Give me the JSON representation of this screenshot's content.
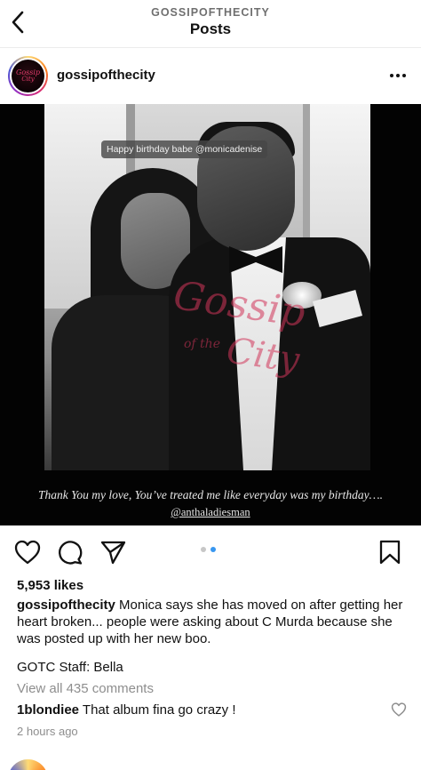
{
  "header": {
    "account_label": "GOSSIPOFTHECITY",
    "title": "Posts"
  },
  "post": {
    "username": "gossipofthecity",
    "avatar_text_1": "Gossip",
    "avatar_text_2": "City",
    "media": {
      "sticker_text": "Happy birthday babe @monicadenise",
      "caption_line": "Thank You my love, You’ve treated me like everyday was my birthday….",
      "caption_handle": "@anthaladiesman",
      "watermark_1": "Gossip",
      "watermark_2": "City",
      "watermark_3": "of the",
      "carousel_count": 2,
      "carousel_active": 2
    },
    "likes": "5,953 likes",
    "caption_user": "gossipofthecity",
    "caption_text": " Monica says she has moved on after getting her heart broken... people were asking about C Murda because she was posted up with her new boo.",
    "staff_credit": "GOTC Staff: Bella",
    "view_comments": "View all 435 comments",
    "top_comment": {
      "user": "1blondiee",
      "text": " That album fina go crazy !"
    },
    "timestamp": "2 hours ago"
  },
  "icons": {
    "back": "chevron-left-icon",
    "more": "more-horizontal-icon",
    "like": "heart-icon",
    "comment": "comment-icon",
    "share": "send-icon",
    "save": "bookmark-icon"
  },
  "colors": {
    "dot_active": "#3897f0",
    "dot_inactive": "#c7c7c7",
    "muted_text": "#8e8e8e"
  }
}
